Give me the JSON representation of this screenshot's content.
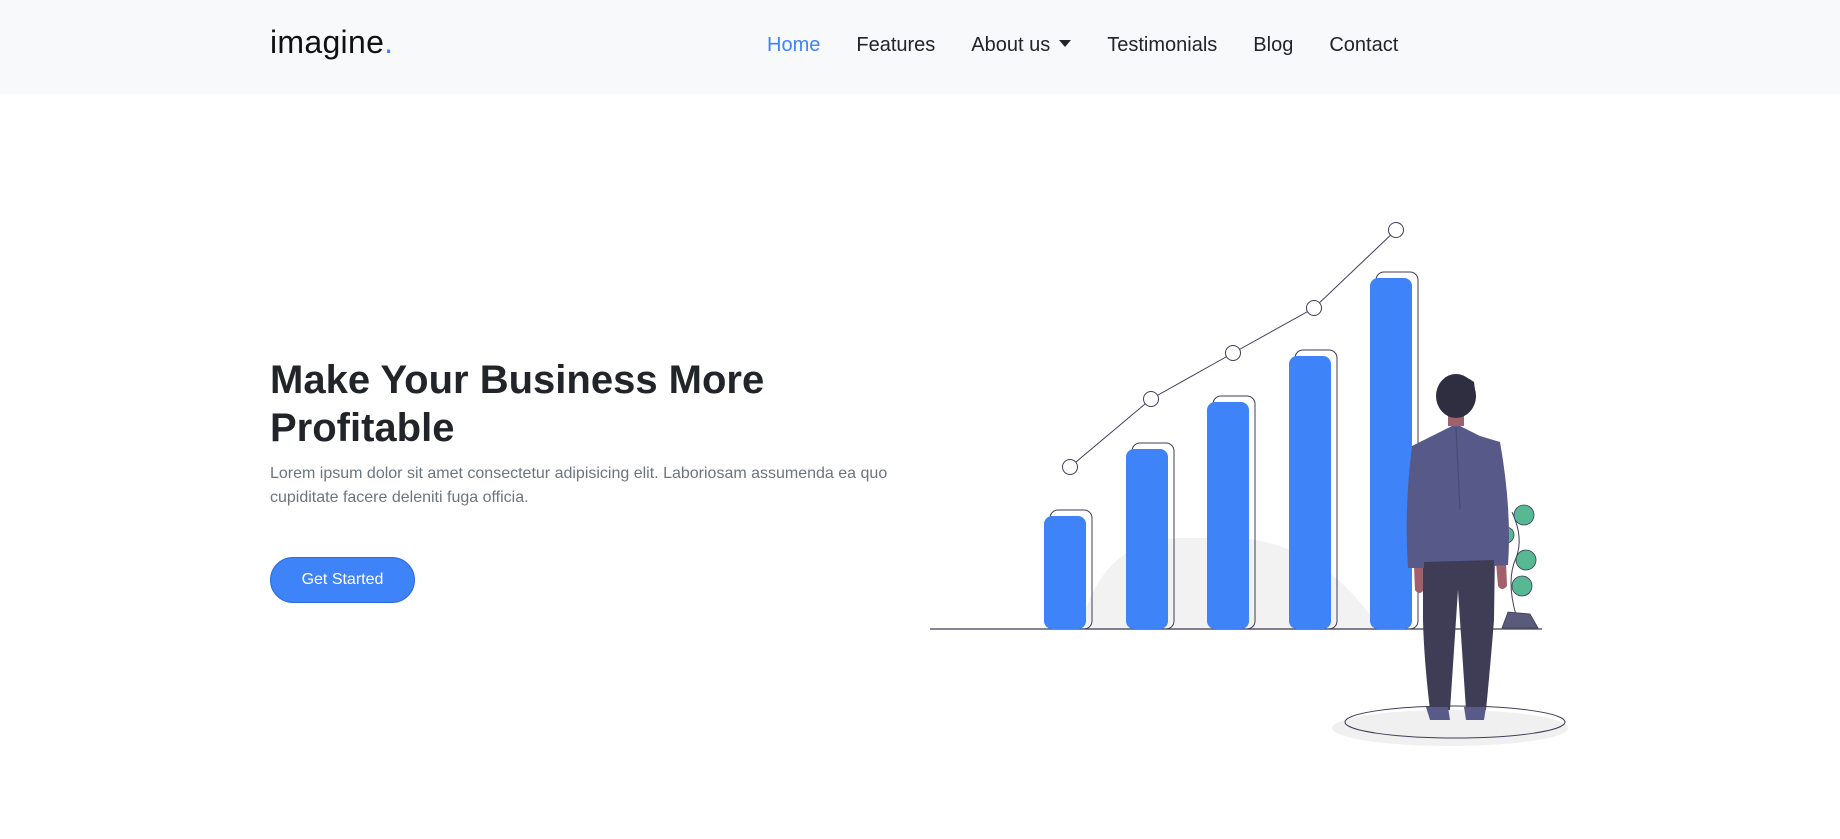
{
  "brand": {
    "name": "imagine",
    "dot": "."
  },
  "nav": {
    "items": [
      {
        "label": "Home",
        "active": true
      },
      {
        "label": "Features"
      },
      {
        "label": "About us",
        "dropdown": true
      },
      {
        "label": "Testimonials"
      },
      {
        "label": "Blog"
      },
      {
        "label": "Contact"
      }
    ]
  },
  "hero": {
    "title": "Make Your Business More Profitable",
    "text": "Lorem ipsum dolor sit amet consectetur adipisicing elit. Laboriosam assumenda ea quo cupiditate facere deleniti fuga officia.",
    "cta_label": "Get Started"
  },
  "colors": {
    "accent": "#3f83f8",
    "navbar_bg": "#f8f9fa",
    "body_text": "#6c757d"
  },
  "icons": [
    "caret-down-icon"
  ]
}
